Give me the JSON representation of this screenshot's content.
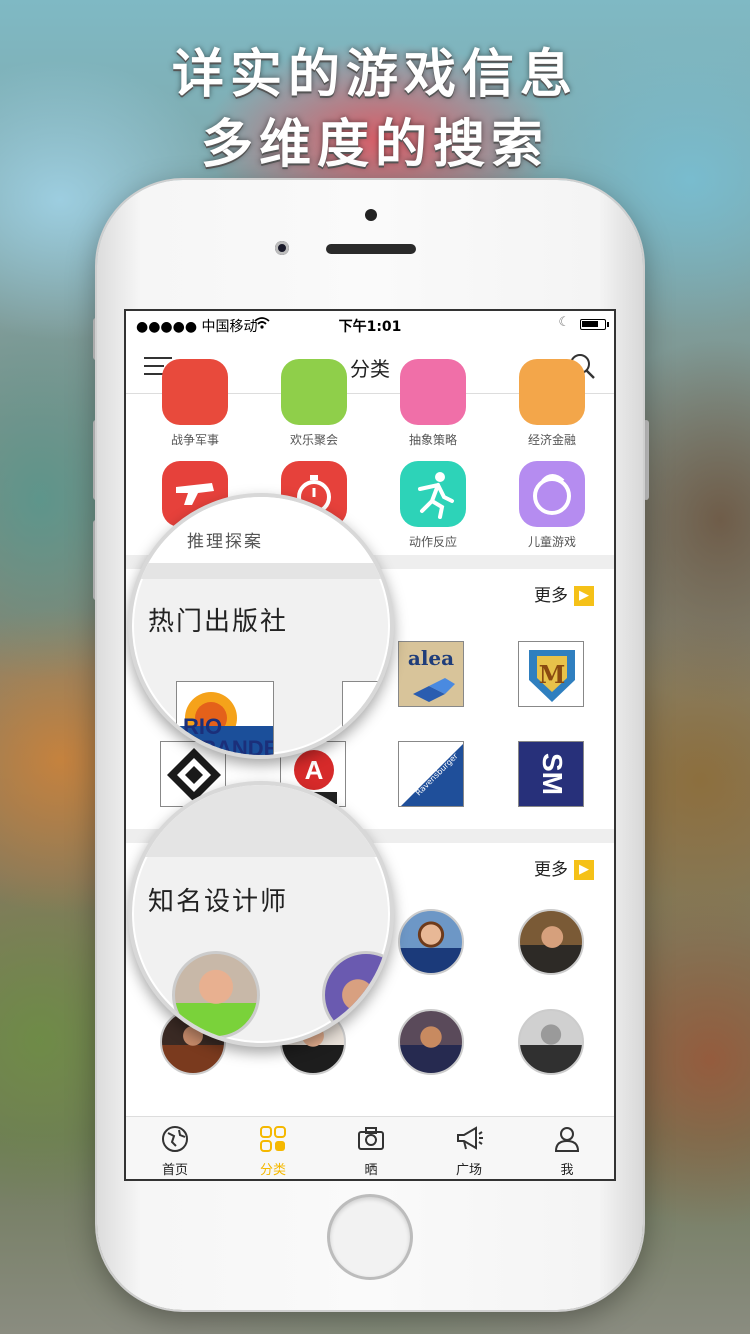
{
  "headline": {
    "line1": "详实的游戏信息",
    "line2": "多维度的搜索"
  },
  "status_bar": {
    "carrier": "●●●●● 中国移动",
    "time": "下午1:01",
    "battery_level": 0.8
  },
  "nav": {
    "title": "分类"
  },
  "categories_row1": [
    "战争军事",
    "欢乐聚会",
    "抽象策略",
    "经济金融"
  ],
  "categories_row2": [
    "推理探案",
    "",
    "动作反应",
    "儿童游戏"
  ],
  "publishers": {
    "title": "热门出版社",
    "more": "更多",
    "logos": [
      "RIO GRANDE",
      "",
      "alea",
      "M",
      "FFG",
      "A",
      "Ravensburger",
      "SM"
    ]
  },
  "designers": {
    "title": "知名设计师",
    "more": "更多"
  },
  "tabs": [
    {
      "label": "首页",
      "icon": "globe-icon"
    },
    {
      "label": "分类",
      "icon": "grid-icon",
      "active": true
    },
    {
      "label": "晒",
      "icon": "camera-icon"
    },
    {
      "label": "广场",
      "icon": "megaphone-icon"
    },
    {
      "label": "我",
      "icon": "person-icon"
    }
  ],
  "colors": {
    "accent": "#f5b800",
    "more_arrow": "#f5c118"
  }
}
